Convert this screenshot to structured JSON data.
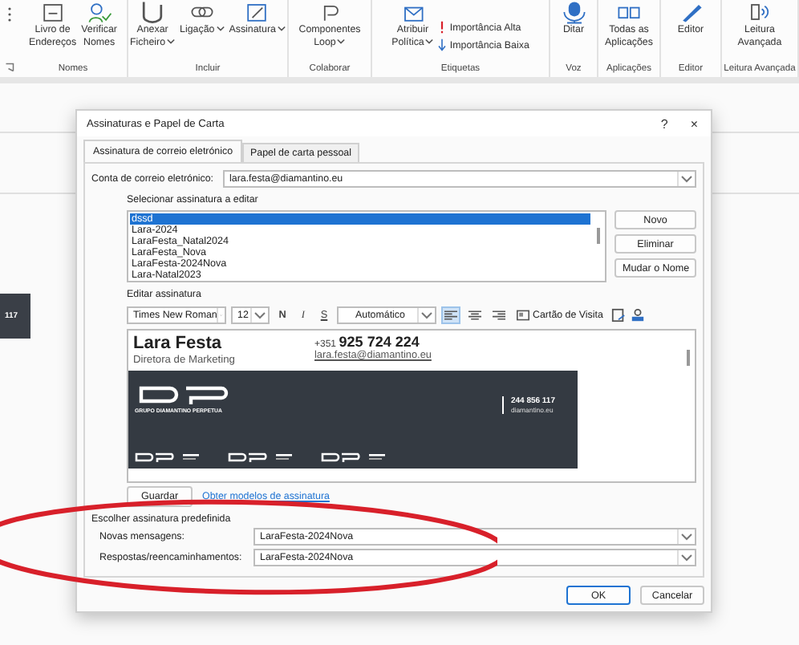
{
  "ribbon": {
    "groups": [
      {
        "label": "Nomes",
        "buttons": [
          {
            "label": "Livro de\nEndereços",
            "dropdown": false
          },
          {
            "label": "Verificar\nNomes",
            "dropdown": false
          }
        ]
      },
      {
        "label": "Incluir",
        "buttons": [
          {
            "label": "Anexar\nFicheiro",
            "dropdown": true
          },
          {
            "label": "Ligação",
            "dropdown": true
          },
          {
            "label": "Assinatura",
            "dropdown": true
          }
        ]
      },
      {
        "label": "Colaborar",
        "buttons": [
          {
            "label": "Componentes\nLoop",
            "dropdown": true
          }
        ]
      },
      {
        "label": "Etiquetas",
        "buttons": [
          {
            "label": "Atribuir\nPolítica",
            "dropdown": true
          }
        ],
        "small_buttons": [
          "Importância Alta",
          "Importância Baixa"
        ]
      },
      {
        "label": "Voz",
        "buttons": [
          {
            "label": "Ditar",
            "dropdown": false
          }
        ]
      },
      {
        "label": "Aplicações",
        "buttons": [
          {
            "label": "Todas as\nAplicações",
            "dropdown": false
          }
        ]
      },
      {
        "label": "Editor",
        "buttons": [
          {
            "label": "Editor",
            "dropdown": false
          }
        ]
      },
      {
        "label": "Leitura Avançada",
        "buttons": [
          {
            "label": "Leitura\nAvançada",
            "dropdown": false
          }
        ]
      }
    ]
  },
  "background_card": {
    "text": "117"
  },
  "dialog": {
    "title": "Assinaturas e Papel de Carta",
    "help": "?",
    "close": "×",
    "tabs": [
      {
        "label": "Assinatura de correio eletrónico",
        "selected": true
      },
      {
        "label": "Papel de carta pessoal",
        "selected": false
      }
    ],
    "account": {
      "label": "Conta de correio eletrónico:",
      "value": "lara.festa@diamantino.eu"
    },
    "select_label": "Selecionar assinatura a editar",
    "signatures": [
      {
        "name": "dssd",
        "selected": true
      },
      {
        "name": "Lara-2024",
        "selected": false
      },
      {
        "name": "LaraFesta_Natal2024",
        "selected": false
      },
      {
        "name": "LaraFesta_Nova",
        "selected": false
      },
      {
        "name": "LaraFesta-2024Nova",
        "selected": false
      },
      {
        "name": "Lara-Natal2023",
        "selected": false
      }
    ],
    "list_buttons": [
      "Novo",
      "Eliminar",
      "Mudar o Nome"
    ],
    "edit_label": "Editar assinatura",
    "toolbar": {
      "font": "Times New Roman",
      "size": "12",
      "bold": "N",
      "italic": "I",
      "underline": "S",
      "text_color": "Automático",
      "align": [
        {
          "selected": true
        },
        {
          "selected": false
        },
        {
          "selected": false
        }
      ],
      "business_card": "Cartão de Visita"
    },
    "signature": {
      "name": "Lara Festa",
      "role": "Diretora de Marketing",
      "phone_prefix": "+351",
      "phone": "925 724 224",
      "email": "lara.festa@diamantino.eu",
      "banner": {
        "group": "GRUPO DIAMANTINO PERPETUA",
        "phone": "244 856 117",
        "site": "diamantino.eu"
      }
    },
    "save": "Guardar",
    "templates_link": "Obter modelos de assinatura",
    "default_label": "Escolher assinatura predefinida",
    "defaults": [
      {
        "label": "Novas mensagens:",
        "value": "LaraFesta-2024Nova"
      },
      {
        "label": "Respostas/reencaminhamentos:",
        "value": "LaraFesta-2024Nova"
      }
    ],
    "buttons": [
      "OK",
      "Cancelar"
    ]
  }
}
